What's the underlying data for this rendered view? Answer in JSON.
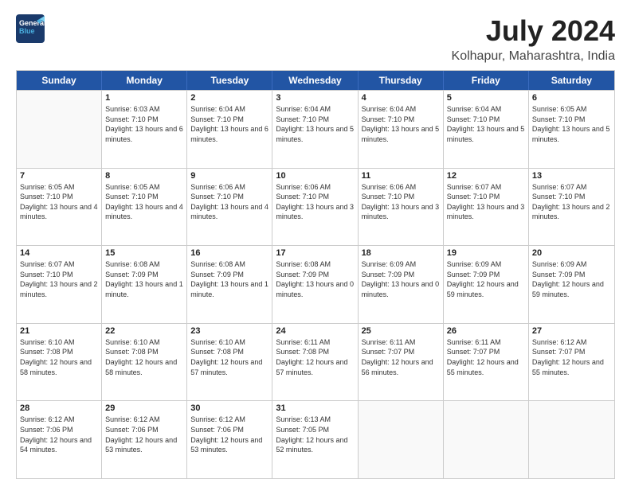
{
  "header": {
    "logo_general": "General",
    "logo_blue": "Blue",
    "month_title": "July 2024",
    "location": "Kolhapur, Maharashtra, India"
  },
  "days_of_week": [
    "Sunday",
    "Monday",
    "Tuesday",
    "Wednesday",
    "Thursday",
    "Friday",
    "Saturday"
  ],
  "weeks": [
    [
      {
        "day": "",
        "sunrise": "",
        "sunset": "",
        "daylight": ""
      },
      {
        "day": "1",
        "sunrise": "Sunrise: 6:03 AM",
        "sunset": "Sunset: 7:10 PM",
        "daylight": "Daylight: 13 hours and 6 minutes."
      },
      {
        "day": "2",
        "sunrise": "Sunrise: 6:04 AM",
        "sunset": "Sunset: 7:10 PM",
        "daylight": "Daylight: 13 hours and 6 minutes."
      },
      {
        "day": "3",
        "sunrise": "Sunrise: 6:04 AM",
        "sunset": "Sunset: 7:10 PM",
        "daylight": "Daylight: 13 hours and 5 minutes."
      },
      {
        "day": "4",
        "sunrise": "Sunrise: 6:04 AM",
        "sunset": "Sunset: 7:10 PM",
        "daylight": "Daylight: 13 hours and 5 minutes."
      },
      {
        "day": "5",
        "sunrise": "Sunrise: 6:04 AM",
        "sunset": "Sunset: 7:10 PM",
        "daylight": "Daylight: 13 hours and 5 minutes."
      },
      {
        "day": "6",
        "sunrise": "Sunrise: 6:05 AM",
        "sunset": "Sunset: 7:10 PM",
        "daylight": "Daylight: 13 hours and 5 minutes."
      }
    ],
    [
      {
        "day": "7",
        "sunrise": "Sunrise: 6:05 AM",
        "sunset": "Sunset: 7:10 PM",
        "daylight": "Daylight: 13 hours and 4 minutes."
      },
      {
        "day": "8",
        "sunrise": "Sunrise: 6:05 AM",
        "sunset": "Sunset: 7:10 PM",
        "daylight": "Daylight: 13 hours and 4 minutes."
      },
      {
        "day": "9",
        "sunrise": "Sunrise: 6:06 AM",
        "sunset": "Sunset: 7:10 PM",
        "daylight": "Daylight: 13 hours and 4 minutes."
      },
      {
        "day": "10",
        "sunrise": "Sunrise: 6:06 AM",
        "sunset": "Sunset: 7:10 PM",
        "daylight": "Daylight: 13 hours and 3 minutes."
      },
      {
        "day": "11",
        "sunrise": "Sunrise: 6:06 AM",
        "sunset": "Sunset: 7:10 PM",
        "daylight": "Daylight: 13 hours and 3 minutes."
      },
      {
        "day": "12",
        "sunrise": "Sunrise: 6:07 AM",
        "sunset": "Sunset: 7:10 PM",
        "daylight": "Daylight: 13 hours and 3 minutes."
      },
      {
        "day": "13",
        "sunrise": "Sunrise: 6:07 AM",
        "sunset": "Sunset: 7:10 PM",
        "daylight": "Daylight: 13 hours and 2 minutes."
      }
    ],
    [
      {
        "day": "14",
        "sunrise": "Sunrise: 6:07 AM",
        "sunset": "Sunset: 7:10 PM",
        "daylight": "Daylight: 13 hours and 2 minutes."
      },
      {
        "day": "15",
        "sunrise": "Sunrise: 6:08 AM",
        "sunset": "Sunset: 7:09 PM",
        "daylight": "Daylight: 13 hours and 1 minute."
      },
      {
        "day": "16",
        "sunrise": "Sunrise: 6:08 AM",
        "sunset": "Sunset: 7:09 PM",
        "daylight": "Daylight: 13 hours and 1 minute."
      },
      {
        "day": "17",
        "sunrise": "Sunrise: 6:08 AM",
        "sunset": "Sunset: 7:09 PM",
        "daylight": "Daylight: 13 hours and 0 minutes."
      },
      {
        "day": "18",
        "sunrise": "Sunrise: 6:09 AM",
        "sunset": "Sunset: 7:09 PM",
        "daylight": "Daylight: 13 hours and 0 minutes."
      },
      {
        "day": "19",
        "sunrise": "Sunrise: 6:09 AM",
        "sunset": "Sunset: 7:09 PM",
        "daylight": "Daylight: 12 hours and 59 minutes."
      },
      {
        "day": "20",
        "sunrise": "Sunrise: 6:09 AM",
        "sunset": "Sunset: 7:09 PM",
        "daylight": "Daylight: 12 hours and 59 minutes."
      }
    ],
    [
      {
        "day": "21",
        "sunrise": "Sunrise: 6:10 AM",
        "sunset": "Sunset: 7:08 PM",
        "daylight": "Daylight: 12 hours and 58 minutes."
      },
      {
        "day": "22",
        "sunrise": "Sunrise: 6:10 AM",
        "sunset": "Sunset: 7:08 PM",
        "daylight": "Daylight: 12 hours and 58 minutes."
      },
      {
        "day": "23",
        "sunrise": "Sunrise: 6:10 AM",
        "sunset": "Sunset: 7:08 PM",
        "daylight": "Daylight: 12 hours and 57 minutes."
      },
      {
        "day": "24",
        "sunrise": "Sunrise: 6:11 AM",
        "sunset": "Sunset: 7:08 PM",
        "daylight": "Daylight: 12 hours and 57 minutes."
      },
      {
        "day": "25",
        "sunrise": "Sunrise: 6:11 AM",
        "sunset": "Sunset: 7:07 PM",
        "daylight": "Daylight: 12 hours and 56 minutes."
      },
      {
        "day": "26",
        "sunrise": "Sunrise: 6:11 AM",
        "sunset": "Sunset: 7:07 PM",
        "daylight": "Daylight: 12 hours and 55 minutes."
      },
      {
        "day": "27",
        "sunrise": "Sunrise: 6:12 AM",
        "sunset": "Sunset: 7:07 PM",
        "daylight": "Daylight: 12 hours and 55 minutes."
      }
    ],
    [
      {
        "day": "28",
        "sunrise": "Sunrise: 6:12 AM",
        "sunset": "Sunset: 7:06 PM",
        "daylight": "Daylight: 12 hours and 54 minutes."
      },
      {
        "day": "29",
        "sunrise": "Sunrise: 6:12 AM",
        "sunset": "Sunset: 7:06 PM",
        "daylight": "Daylight: 12 hours and 53 minutes."
      },
      {
        "day": "30",
        "sunrise": "Sunrise: 6:12 AM",
        "sunset": "Sunset: 7:06 PM",
        "daylight": "Daylight: 12 hours and 53 minutes."
      },
      {
        "day": "31",
        "sunrise": "Sunrise: 6:13 AM",
        "sunset": "Sunset: 7:05 PM",
        "daylight": "Daylight: 12 hours and 52 minutes."
      },
      {
        "day": "",
        "sunrise": "",
        "sunset": "",
        "daylight": ""
      },
      {
        "day": "",
        "sunrise": "",
        "sunset": "",
        "daylight": ""
      },
      {
        "day": "",
        "sunrise": "",
        "sunset": "",
        "daylight": ""
      }
    ]
  ]
}
